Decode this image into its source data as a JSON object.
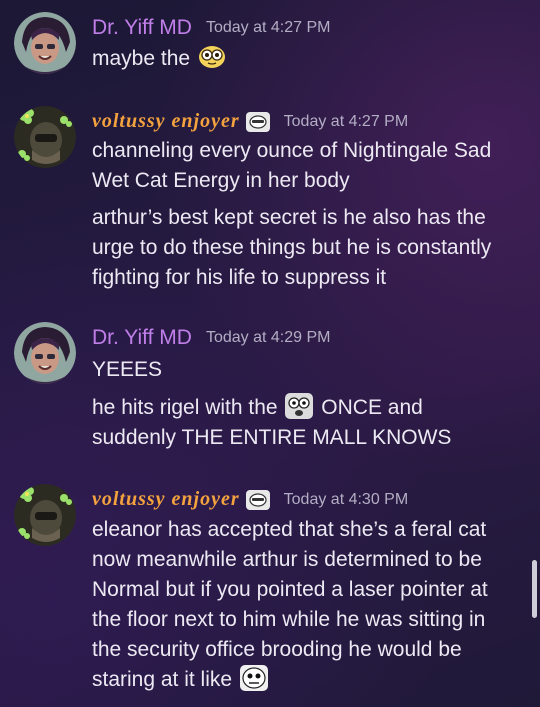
{
  "colors": {
    "username_purple": "#c07ee8",
    "username_fancy": "#f3a23e",
    "timestamp": "#b3aec4",
    "message_text": "#ece9f3"
  },
  "messages": [
    {
      "author": "Dr. Yiff MD",
      "timestamp": "Today at 4:27 PM",
      "avatar_icon": "dark-haired-character-avatar",
      "lines": [
        {
          "text": "maybe the",
          "emoji": "flushed-eyes-emoji"
        }
      ]
    },
    {
      "author": "voltussy enjoyer",
      "timestamp": "Today at 4:27 PM",
      "avatar_icon": "masked-character-clover-avatar",
      "badge_icon": "server-badge-icon",
      "lines": [
        {
          "text": "channeling every ounce of Nightingale Sad"
        },
        {
          "text": "Wet Cat Energy in her body"
        },
        {
          "text": "arthur’s best kept secret is he also has the"
        },
        {
          "text": "urge to do these things but he is constantly"
        },
        {
          "text": "fighting for his life to suppress it"
        }
      ]
    },
    {
      "author": "Dr. Yiff MD",
      "timestamp": "Today at 4:29 PM",
      "avatar_icon": "dark-haired-character-avatar",
      "lines": [
        {
          "text": "YEEES"
        },
        {
          "text_before": "he hits rigel with the",
          "emoji": "shocked-face-emoji",
          "text_after": "ONCE and"
        },
        {
          "text": "suddenly THE ENTIRE MALL KNOWS"
        }
      ]
    },
    {
      "author": "voltussy enjoyer",
      "timestamp": "Today at 4:30 PM",
      "avatar_icon": "masked-character-clover-avatar",
      "badge_icon": "server-badge-icon",
      "lines": [
        {
          "text": "eleanor has accepted that she’s a feral cat"
        },
        {
          "text": "now meanwhile arthur is determined to be"
        },
        {
          "text": "Normal but if you pointed a laser pointer at"
        },
        {
          "text": "the floor next to him while he was sitting in"
        },
        {
          "text": "the security office brooding he would be"
        },
        {
          "text": "staring at it like",
          "emoji": "staring-face-emoji"
        }
      ]
    }
  ]
}
